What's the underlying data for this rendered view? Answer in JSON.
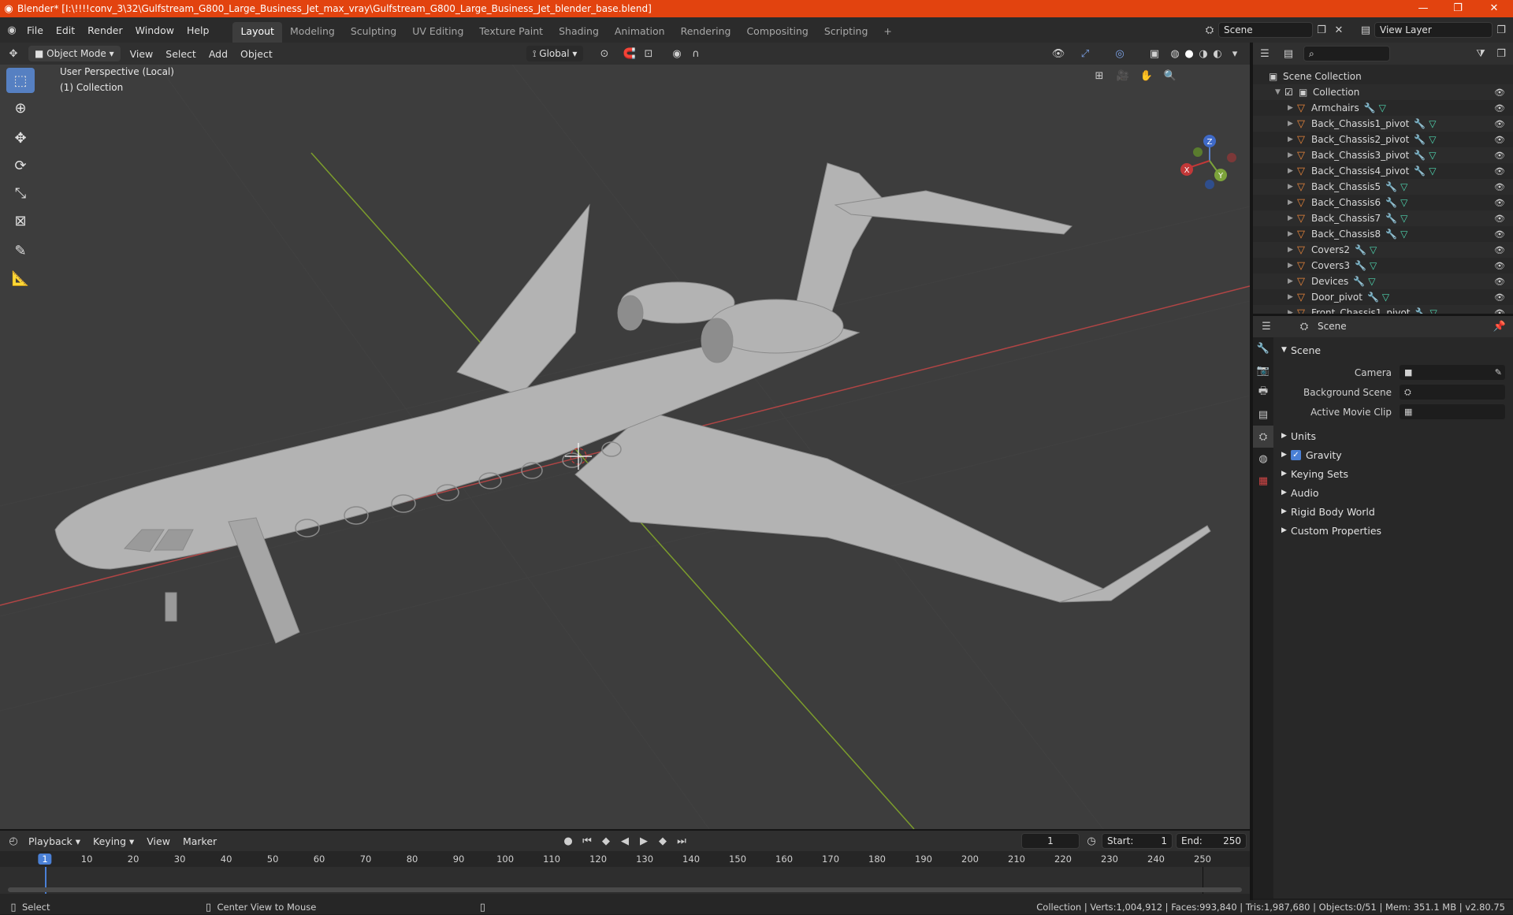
{
  "title_bar": {
    "text": "Blender* [I:\\!!!!conv_3\\32\\Gulfstream_G800_Large_Business_Jet_max_vray\\Gulfstream_G800_Large_Business_Jet_blender_base.blend]",
    "minimize": "—",
    "maximize": "❐",
    "close": "✕"
  },
  "menu": [
    "File",
    "Edit",
    "Render",
    "Window",
    "Help"
  ],
  "workspaces": [
    "Layout",
    "Modeling",
    "Sculpting",
    "UV Editing",
    "Texture Paint",
    "Shading",
    "Animation",
    "Rendering",
    "Compositing",
    "Scripting"
  ],
  "workspace_add": "+",
  "scene_field": "Scene",
  "view_layer_field": "View Layer",
  "viewport_header": {
    "mode": "Object Mode",
    "menus": [
      "View",
      "Select",
      "Add",
      "Object"
    ],
    "transform": "Global"
  },
  "viewport": {
    "perspective": "User Perspective (Local)",
    "collection": "(1) Collection",
    "gizmo": {
      "x": "X",
      "y": "Y",
      "z": "Z"
    }
  },
  "outliner": {
    "root": "Scene Collection",
    "collection": "Collection",
    "items": [
      "Armchairs",
      "Back_Chassis1_pivot",
      "Back_Chassis2_pivot",
      "Back_Chassis3_pivot",
      "Back_Chassis4_pivot",
      "Back_Chassis5",
      "Back_Chassis6",
      "Back_Chassis7",
      "Back_Chassis8",
      "Covers2",
      "Covers3",
      "Devices",
      "Door_pivot",
      "Front_Chassis1_pivot"
    ]
  },
  "properties": {
    "header": "Scene",
    "section": "Scene",
    "camera_label": "Camera",
    "bg_scene_label": "Background Scene",
    "movie_clip_label": "Active Movie Clip",
    "panels": [
      "Units",
      "Gravity",
      "Keying Sets",
      "Audio",
      "Rigid Body World",
      "Custom Properties"
    ]
  },
  "timeline": {
    "menus": [
      "Playback",
      "Keying",
      "View",
      "Marker"
    ],
    "current_frame": "1",
    "start_label": "Start:",
    "start": "1",
    "end_label": "End:",
    "end": "250",
    "ticks": [
      "1",
      "10",
      "20",
      "30",
      "40",
      "50",
      "60",
      "70",
      "80",
      "90",
      "100",
      "110",
      "120",
      "130",
      "140",
      "150",
      "160",
      "170",
      "180",
      "190",
      "200",
      "210",
      "220",
      "230",
      "240",
      "250"
    ]
  },
  "status": {
    "select": "Select",
    "center": "Center View to Mouse",
    "stats": "Collection | Verts:1,004,912 | Faces:993,840 | Tris:1,987,680 | Objects:0/51 | Mem: 351.1 MB | v2.80.75"
  },
  "colors": {
    "title_bar": "#e2430f",
    "viewport_bg": "#3d3d3d",
    "x_axis": "#b04545",
    "y_axis": "#7c9d2c",
    "active_tool": "#5680c2",
    "playhead": "#4a80d6"
  }
}
